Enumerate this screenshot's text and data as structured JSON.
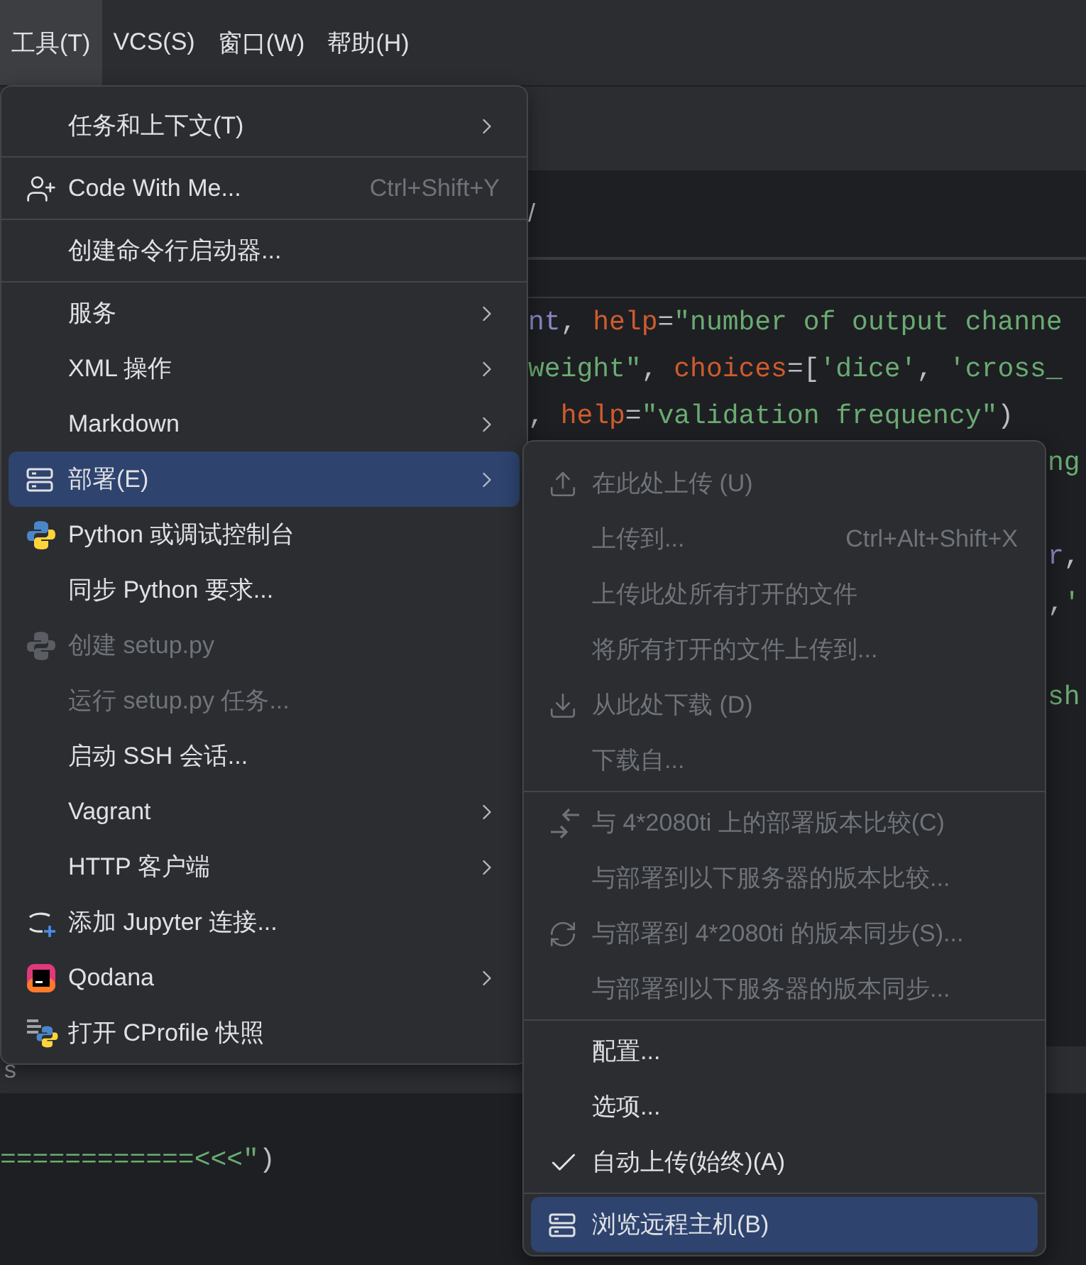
{
  "menubar": [
    {
      "label": "工具(T)",
      "selected": true
    },
    {
      "label": "VCS(S)",
      "selected": false
    },
    {
      "label": "窗口(W)",
      "selected": false
    },
    {
      "label": "帮助(H)",
      "selected": false
    }
  ],
  "editor": {
    "breadcrumb": "/",
    "lines": [
      {
        "tokens": [
          {
            "kind": "builtin",
            "text": "nt"
          },
          {
            "kind": "plain",
            "text": ", "
          },
          {
            "kind": "param",
            "text": "help"
          },
          {
            "kind": "plain",
            "text": "="
          },
          {
            "kind": "string",
            "text": "\"number of output channe"
          }
        ]
      },
      {
        "tokens": [
          {
            "kind": "string",
            "text": "weight\""
          },
          {
            "kind": "plain",
            "text": ", "
          },
          {
            "kind": "param",
            "text": "choices"
          },
          {
            "kind": "plain",
            "text": "=["
          },
          {
            "kind": "string",
            "text": "'dice'"
          },
          {
            "kind": "plain",
            "text": ", "
          },
          {
            "kind": "string",
            "text": "'cross_"
          }
        ]
      },
      {
        "tokens": [
          {
            "kind": "plain",
            "text": ", "
          },
          {
            "kind": "param",
            "text": "help"
          },
          {
            "kind": "plain",
            "text": "="
          },
          {
            "kind": "string",
            "text": "\"validation frequency\""
          },
          {
            "kind": "plain",
            "text": ")"
          }
        ]
      }
    ],
    "right_fragments": [
      {
        "gap_before": false,
        "tokens": [
          {
            "kind": "string",
            "text": "ng"
          }
        ]
      },
      {
        "gap_before": true,
        "tokens": [
          {
            "kind": "builtin",
            "text": "r"
          },
          {
            "kind": "plain",
            "text": ","
          }
        ]
      },
      {
        "gap_before": false,
        "tokens": [
          {
            "kind": "plain",
            "text": ","
          },
          {
            "kind": "string",
            "text": "'"
          }
        ]
      },
      {
        "gap_before": true,
        "tokens": [
          {
            "kind": "string",
            "text": "sh"
          }
        ]
      }
    ],
    "panel_tab": "s",
    "console_line": [
      {
        "kind": "string",
        "text": "============<<<\""
      },
      {
        "kind": "plain",
        "text": ")"
      }
    ]
  },
  "menu": {
    "sections": [
      {
        "items": [
          {
            "label": "任务和上下文(T)",
            "submenu": true,
            "disabled": false,
            "selected": false
          }
        ]
      },
      {
        "items": [
          {
            "label": "Code With Me...",
            "shortcut": "Ctrl+Shift+Y",
            "submenu": false,
            "disabled": false,
            "selected": false
          }
        ]
      },
      {
        "items": [
          {
            "label": "创建命令行启动器...",
            "submenu": false,
            "disabled": false,
            "selected": false
          }
        ]
      },
      {
        "items": [
          {
            "label": "服务",
            "submenu": true,
            "disabled": false,
            "selected": false
          },
          {
            "label": "XML 操作",
            "submenu": true,
            "disabled": false,
            "selected": false
          },
          {
            "label": "Markdown",
            "submenu": true,
            "disabled": false,
            "selected": false
          },
          {
            "label": "部署(E)",
            "submenu": true,
            "disabled": false,
            "selected": true
          },
          {
            "label": "Python 或调试控制台",
            "submenu": false,
            "disabled": false,
            "selected": false
          },
          {
            "label": "同步 Python 要求...",
            "submenu": false,
            "disabled": false,
            "selected": false
          },
          {
            "label": "创建 setup.py",
            "submenu": false,
            "disabled": true,
            "selected": false
          },
          {
            "label": "运行 setup.py 任务...",
            "submenu": false,
            "disabled": true,
            "selected": false
          },
          {
            "label": "启动 SSH 会话...",
            "submenu": false,
            "disabled": false,
            "selected": false
          },
          {
            "label": "Vagrant",
            "submenu": true,
            "disabled": false,
            "selected": false
          },
          {
            "label": "HTTP 客户端",
            "submenu": true,
            "disabled": false,
            "selected": false
          },
          {
            "label": "添加 Jupyter 连接...",
            "submenu": false,
            "disabled": false,
            "selected": false
          },
          {
            "label": "Qodana",
            "submenu": true,
            "disabled": false,
            "selected": false
          },
          {
            "label": "打开 CProfile 快照",
            "submenu": false,
            "disabled": false,
            "selected": false
          }
        ]
      }
    ]
  },
  "submenu": {
    "sections": [
      {
        "items": [
          {
            "label": "在此处上传 (U)",
            "disabled": true,
            "selected": false
          },
          {
            "label": "上传到...",
            "shortcut": "Ctrl+Alt+Shift+X",
            "disabled": true,
            "selected": false
          },
          {
            "label": "上传此处所有打开的文件",
            "disabled": true,
            "selected": false
          },
          {
            "label": "将所有打开的文件上传到...",
            "disabled": true,
            "selected": false
          },
          {
            "label": "从此处下载 (D)",
            "disabled": true,
            "selected": false
          },
          {
            "label": "下载自...",
            "disabled": true,
            "selected": false
          }
        ]
      },
      {
        "items": [
          {
            "label": "与 4*2080ti 上的部署版本比较(C)",
            "disabled": true,
            "selected": false
          },
          {
            "label": "与部署到以下服务器的版本比较...",
            "disabled": true,
            "selected": false
          },
          {
            "label": "与部署到 4*2080ti 的版本同步(S)...",
            "disabled": true,
            "selected": false
          },
          {
            "label": "与部署到以下服务器的版本同步...",
            "disabled": true,
            "selected": false
          }
        ]
      },
      {
        "items": [
          {
            "label": "配置...",
            "disabled": false,
            "selected": false,
            "checked": false
          },
          {
            "label": "选项...",
            "disabled": false,
            "selected": false,
            "checked": false
          },
          {
            "label": "自动上传(始终)(A)",
            "disabled": false,
            "selected": false,
            "checked": true
          }
        ]
      },
      {
        "items": [
          {
            "label": "浏览远程主机(B)",
            "disabled": false,
            "selected": true
          }
        ]
      }
    ]
  }
}
